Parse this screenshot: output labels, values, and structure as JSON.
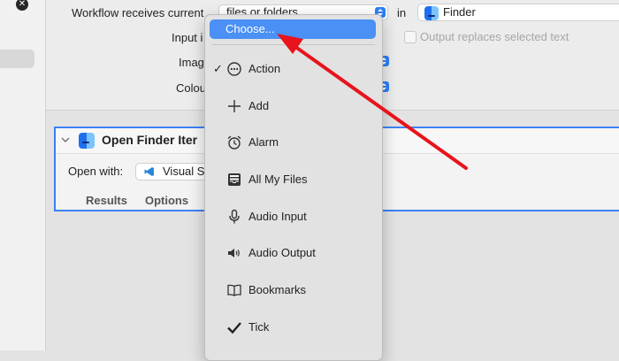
{
  "header": {
    "workflow_label": "Workflow receives current",
    "input_label": "files or folders",
    "in_label": "in",
    "app_label": "Finder",
    "input_row_label": "Input i",
    "image_row_label": "Imag",
    "colour_row_label": "Colou",
    "output_checkbox_label": "Output replaces selected text"
  },
  "card": {
    "title": "Open Finder Iter",
    "open_with_label": "Open with:",
    "app_value": "Visual S",
    "tabs": [
      "Results",
      "Options"
    ]
  },
  "menu": {
    "choose_label": "Choose...",
    "items": [
      {
        "label": "Action",
        "icon": "action-icon",
        "checked": true
      },
      {
        "label": "Add",
        "icon": "plus-icon"
      },
      {
        "label": "Alarm",
        "icon": "alarm-clock-icon"
      },
      {
        "label": "All My Files",
        "icon": "tray-icon"
      },
      {
        "label": "Audio Input",
        "icon": "microphone-icon"
      },
      {
        "label": "Audio Output",
        "icon": "speaker-icon"
      },
      {
        "label": "Bookmarks",
        "icon": "book-icon"
      },
      {
        "label": "Tick",
        "icon": "checkmark-icon"
      }
    ],
    "check_glyph": "✓"
  },
  "colors": {
    "accent": "#4a90f5",
    "card_border": "#3b82f6",
    "annotation_arrow": "#e8131b"
  }
}
